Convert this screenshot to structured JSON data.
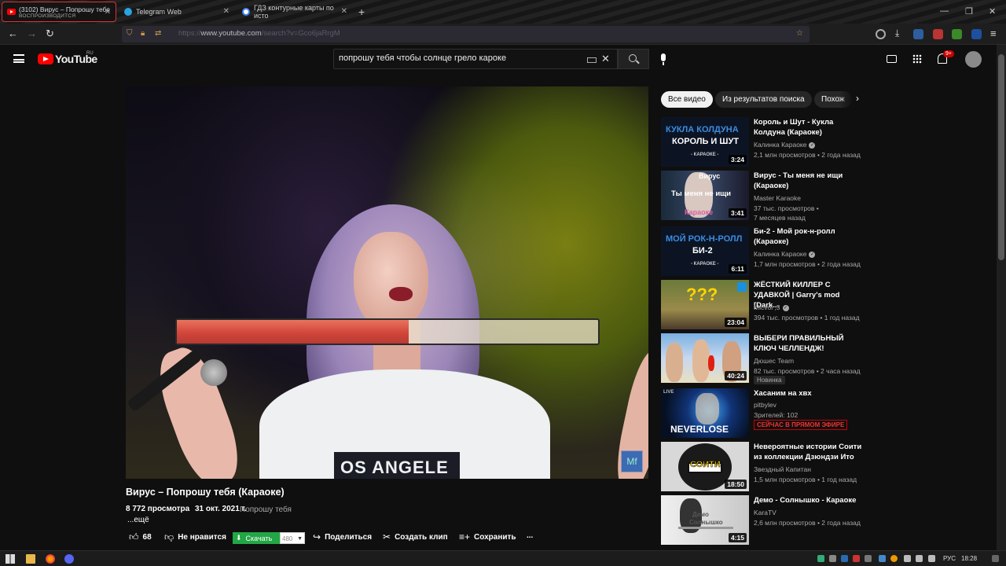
{
  "browser": {
    "tabs": [
      {
        "title": "(3102) Вирус – Попрошу тебя",
        "subtitle": "ВОСПРОИЗВОДИТСЯ",
        "active": true
      },
      {
        "title": "Telegram Web"
      },
      {
        "title": "ГДЗ контурные карты по исто"
      }
    ],
    "url_host": "www.youtube.com",
    "url_prefix": "https://",
    "url_path": "/search?v=Gco6jaRrgM"
  },
  "youtube": {
    "logo_text": "YouTube",
    "region": "RU",
    "search_value": "попрошу тебя чтобы солнце грело кароке",
    "notifications_badge": "9+"
  },
  "video": {
    "title": "Вирус – Попрошу тебя (Караоке)",
    "views": "8 772 просмотра",
    "date": "31 окт. 2021 г.",
    "channel": "Попрошу тебя",
    "more": "...ещё",
    "karaoke_progress": 0.55,
    "shirt_text": "OS ANGELE",
    "watermark": "Mf",
    "actions": {
      "likes": "68",
      "dislike": "Не нравится",
      "download": "Скачать",
      "quality": "480",
      "share": "Поделиться",
      "clip": "Создать клип",
      "save": "Сохранить",
      "more": "..."
    }
  },
  "chips": [
    "Все видео",
    "Из результатов поиска",
    "Похож"
  ],
  "recommendations": [
    {
      "title": "Король и Шут - Кукла Колдуна (Караоке)",
      "channel": "Калинка Караоке",
      "verified": true,
      "meta": "2,1 млн просмотров • 2 года назад",
      "duration": "3:24",
      "thumb_line1": "КУКЛА КОЛДУНА",
      "thumb_line2": "КОРОЛЬ И ШУТ",
      "thumb_line3": "- КАРАОКЕ -"
    },
    {
      "title": "Вирус - Ты меня не ищи (Караоке)",
      "channel": "Master Karaoke",
      "verified": false,
      "meta": "37 тыс. просмотров •\n7 месяцев назад",
      "duration": "3:41",
      "thumb_line1": "Вирус",
      "thumb_line2": "Ты меня не ищи",
      "thumb_line3": "Караоке"
    },
    {
      "title": "Би-2 - Мой рок-н-ролл (Караоке)",
      "channel": "Калинка Караоке",
      "verified": true,
      "meta": "1,7 млн просмотров • 2 года назад",
      "duration": "6:11",
      "thumb_line1": "МОЙ РОК-Н-РОЛЛ",
      "thumb_line2": "БИ-2",
      "thumb_line3": "- КАРАОКЕ -"
    },
    {
      "title": "ЖЁСТКИЙ КИЛЛЕР С УДАВКОЙ | Garry's mod [Dark...",
      "channel": "Micvol ;3",
      "verified": true,
      "meta": "394 тыс. просмотров • 1 год назад",
      "duration": "23:04",
      "thumb_line1": "???"
    },
    {
      "title": "ВЫБЕРИ ПРАВИЛЬНЫЙ КЛЮЧ ЧЕЛЛЕНДЖ!",
      "channel": "Дюшес Team",
      "verified": false,
      "meta": "82 тыс. просмотров • 2 часа назад",
      "duration": "40:24",
      "badge": "Новинка"
    },
    {
      "title": "Хасаним на хвх",
      "channel": "pitbylev",
      "verified": false,
      "meta": "Зрителей: 102",
      "live": "СЕЙЧАС В ПРЯМОМ ЭФИРЕ",
      "thumb_line1": "NEVERLOSE",
      "thumb_line2": "LIVE"
    },
    {
      "title": "Невероятные истории Соити из коллекции Дзюндзи Ито",
      "channel": "Звездный Капитан",
      "verified": false,
      "meta": "1,5 млн просмотров • 1 год назад",
      "duration": "18:50",
      "thumb_line1": "СОИТИ"
    },
    {
      "title": "Демо - Солнышко - Караоке",
      "channel": "KaraTV",
      "verified": false,
      "meta": "2,6 млн просмотров • 2 года назад",
      "duration": "4:15",
      "thumb_line1": "Демо",
      "thumb_line2": "Солнышко"
    }
  ],
  "taskbar": {
    "lang": "РУС",
    "time": "18:28"
  },
  "colors": {
    "background": "#0f0f0f",
    "accent_red": "#ff0000",
    "download_green": "#23a645",
    "live_red": "#cc0000"
  }
}
